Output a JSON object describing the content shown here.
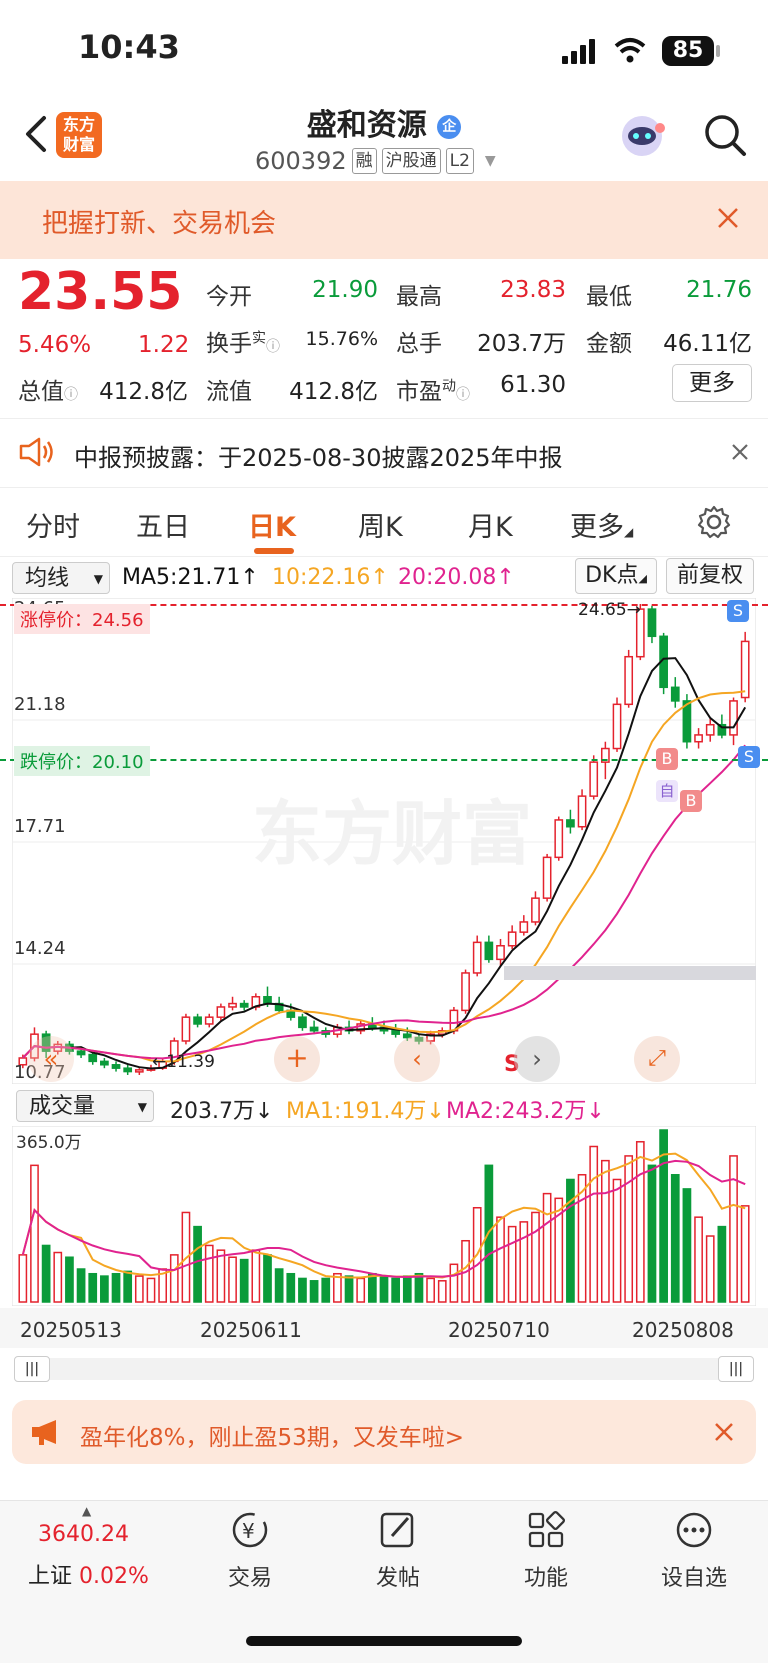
{
  "status_bar": {
    "time": "10:43",
    "battery": "85"
  },
  "header": {
    "logo_text": "东方财富",
    "stock_name": "盛和资源",
    "badge": "企",
    "code": "600392",
    "tags": [
      "融",
      "沪股通",
      "L2"
    ]
  },
  "promo": {
    "text": "把握打新、交易机会"
  },
  "quote": {
    "price": "23.55",
    "change_pct": "5.46%",
    "change": "1.22",
    "open_label": "今开",
    "open": "21.90",
    "high_label": "最高",
    "high": "23.83",
    "low_label": "最低",
    "low": "21.76",
    "turnover_label": "换手",
    "turnover_sup": "实",
    "turnover": "15.76%",
    "volume_label": "总手",
    "volume": "203.7万",
    "amount_label": "金额",
    "amount": "46.11亿",
    "mktcap_label": "总值",
    "mktcap": "412.8亿",
    "float_label": "流值",
    "float": "412.8亿",
    "pe_label": "市盈",
    "pe_sup": "动",
    "pe": "61.30",
    "more": "更多"
  },
  "notice": {
    "text": "中报预披露：于2025-08-30披露2025年中报"
  },
  "tabs": [
    "分时",
    "五日",
    "日K",
    "周K",
    "月K",
    "更多"
  ],
  "active_tab": "日K",
  "ma_bar": {
    "selector": "均线",
    "ma5": "MA5:21.71↑",
    "ma10": "10:22.16↑",
    "ma20": "20:20.08↑",
    "dk_button": "DK点",
    "adjust_button": "前复权"
  },
  "kline": {
    "y_labels": [
      "24.65",
      "21.18",
      "17.71",
      "14.24",
      "10.77"
    ],
    "limit_up": "涨停价：24.56",
    "limit_down": "跌停价：20.10",
    "high_marker": "24.65→",
    "low_marker": "←11.39",
    "watermark": "东方财富",
    "signal_b": "B",
    "signal_s": "S",
    "signal_self": "自"
  },
  "volume_bar": {
    "selector": "成交量",
    "value": "203.7万↓",
    "ma1": "MA1:191.4万↓",
    "ma2": "MA2:243.2万↓",
    "y_label": "365.0万"
  },
  "dates": [
    "20250513",
    "20250611",
    "20250710",
    "20250808"
  ],
  "ad": {
    "text": "盈年化8%，刚止盈53期，又发车啦>"
  },
  "bottom_nav": {
    "index_value": "3640.24",
    "index_name": "上证",
    "index_change": "0.02%",
    "items": [
      "交易",
      "发帖",
      "功能",
      "设自选"
    ]
  },
  "colors": {
    "up": "#e4222d",
    "down": "#0a9b3a",
    "ma5": "#111111",
    "ma10": "#f5a623",
    "ma20": "#e0238f",
    "accent": "#e8631e"
  },
  "chart_data": {
    "type": "candlestick",
    "y_range": [
      10.77,
      24.65
    ],
    "candles": [
      [
        11.1,
        11.4,
        11.0,
        11.3
      ],
      [
        11.3,
        12.2,
        11.2,
        12.0
      ],
      [
        12.0,
        12.1,
        11.3,
        11.5
      ],
      [
        11.5,
        11.8,
        11.4,
        11.7
      ],
      [
        11.7,
        11.8,
        11.4,
        11.5
      ],
      [
        11.5,
        11.6,
        11.3,
        11.4
      ],
      [
        11.4,
        11.5,
        11.1,
        11.2
      ],
      [
        11.2,
        11.3,
        11.0,
        11.1
      ],
      [
        11.1,
        11.2,
        10.9,
        11.0
      ],
      [
        11.0,
        11.1,
        10.8,
        10.9
      ],
      [
        10.9,
        11.0,
        10.8,
        10.95
      ],
      [
        10.95,
        11.1,
        10.9,
        11.0
      ],
      [
        11.0,
        11.3,
        10.95,
        11.2
      ],
      [
        11.2,
        11.9,
        11.1,
        11.8
      ],
      [
        11.8,
        12.6,
        11.7,
        12.5
      ],
      [
        12.5,
        12.6,
        12.2,
        12.3
      ],
      [
        12.3,
        12.6,
        12.2,
        12.5
      ],
      [
        12.5,
        12.9,
        12.4,
        12.8
      ],
      [
        12.8,
        13.1,
        12.7,
        12.9
      ],
      [
        12.9,
        13.0,
        12.7,
        12.8
      ],
      [
        12.8,
        13.2,
        12.7,
        13.1
      ],
      [
        13.1,
        13.4,
        12.8,
        12.9
      ],
      [
        12.9,
        13.1,
        12.6,
        12.7
      ],
      [
        12.7,
        12.9,
        12.4,
        12.5
      ],
      [
        12.5,
        12.6,
        12.1,
        12.2
      ],
      [
        12.2,
        12.4,
        12.0,
        12.1
      ],
      [
        12.1,
        12.2,
        11.9,
        12.0
      ],
      [
        12.0,
        12.3,
        11.9,
        12.2
      ],
      [
        12.2,
        12.4,
        12.0,
        12.1
      ],
      [
        12.1,
        12.4,
        12.0,
        12.3
      ],
      [
        12.3,
        12.5,
        12.1,
        12.2
      ],
      [
        12.2,
        12.4,
        12.0,
        12.1
      ],
      [
        12.1,
        12.3,
        11.9,
        12.0
      ],
      [
        12.0,
        12.2,
        11.8,
        11.9
      ],
      [
        11.9,
        12.0,
        11.7,
        11.8
      ],
      [
        11.8,
        12.1,
        11.7,
        12.0
      ],
      [
        12.0,
        12.2,
        11.9,
        12.1
      ],
      [
        12.1,
        12.8,
        12.0,
        12.7
      ],
      [
        12.7,
        13.9,
        12.6,
        13.8
      ],
      [
        13.8,
        14.9,
        13.7,
        14.7
      ],
      [
        14.7,
        14.9,
        14.1,
        14.2
      ],
      [
        14.2,
        14.8,
        14.0,
        14.6
      ],
      [
        14.6,
        15.2,
        14.5,
        15.0
      ],
      [
        15.0,
        15.5,
        14.9,
        15.3
      ],
      [
        15.3,
        16.2,
        15.2,
        16.0
      ],
      [
        16.0,
        17.3,
        15.9,
        17.2
      ],
      [
        17.2,
        18.4,
        17.1,
        18.3
      ],
      [
        18.3,
        18.6,
        17.9,
        18.1
      ],
      [
        18.1,
        19.2,
        18.0,
        19.0
      ],
      [
        19.0,
        20.2,
        18.9,
        20.0
      ],
      [
        20.0,
        20.6,
        19.5,
        20.4
      ],
      [
        20.4,
        21.9,
        20.3,
        21.7
      ],
      [
        21.7,
        23.3,
        21.6,
        23.1
      ],
      [
        23.1,
        24.65,
        23.0,
        24.5
      ],
      [
        24.5,
        24.6,
        23.5,
        23.7
      ],
      [
        23.7,
        23.8,
        22.0,
        22.2
      ],
      [
        22.2,
        22.5,
        21.6,
        21.8
      ],
      [
        21.8,
        22.0,
        20.4,
        20.6
      ],
      [
        20.6,
        21.0,
        20.4,
        20.8
      ],
      [
        20.8,
        21.3,
        20.6,
        21.1
      ],
      [
        21.1,
        21.4,
        20.7,
        20.8
      ],
      [
        20.8,
        21.9,
        20.5,
        21.8
      ],
      [
        21.9,
        23.83,
        21.76,
        23.55
      ]
    ],
    "volumes": [
      1.0,
      2.9,
      1.2,
      1.05,
      0.95,
      0.7,
      0.6,
      0.55,
      0.6,
      0.65,
      0.55,
      0.5,
      0.7,
      1.0,
      1.9,
      1.6,
      1.2,
      1.1,
      0.95,
      0.9,
      1.1,
      1.0,
      0.7,
      0.6,
      0.5,
      0.45,
      0.5,
      0.6,
      0.55,
      0.5,
      0.6,
      0.55,
      0.5,
      0.55,
      0.6,
      0.5,
      0.45,
      0.8,
      1.3,
      2.0,
      2.9,
      1.8,
      1.6,
      1.7,
      1.9,
      2.3,
      2.2,
      2.6,
      2.7,
      3.3,
      3.0,
      2.6,
      3.1,
      3.4,
      2.9,
      3.65,
      2.7,
      2.4,
      1.8,
      1.4,
      1.6,
      3.1,
      2.04
    ],
    "volume_range": [
      0,
      3.65
    ]
  }
}
